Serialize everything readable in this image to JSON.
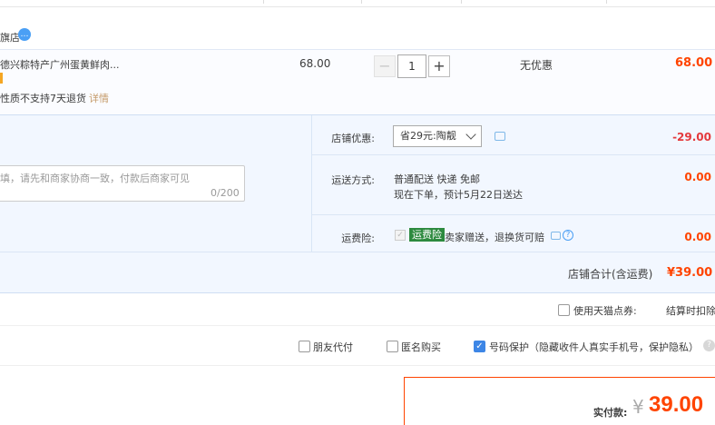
{
  "shop": {
    "name": "旗店"
  },
  "item": {
    "title": "德兴粽特产广州蛋黄鲜肉...",
    "note": "性质不支持7天退货",
    "note_link": "详情",
    "price": "68.00",
    "quantity": "1",
    "promo": "无优惠",
    "subtotal": "68.00"
  },
  "message": {
    "placeholder": "填，请先和商家协商一致，付款后商家可见",
    "counter": "0/200"
  },
  "discount": {
    "label": "店铺优惠:",
    "selected": "省29元:陶靓",
    "amount": "-29.00"
  },
  "shipping": {
    "label": "运送方式:",
    "line1": "普通配送 快递 免邮",
    "line2": "现在下单，预计5月22日送达",
    "amount": "0.00"
  },
  "insurance": {
    "label": "运费险:",
    "badge": "运费险",
    "text": "卖家赠送，退换货可赔",
    "amount": "0.00"
  },
  "shop_total": {
    "label": "店铺合计(含运费)",
    "value": "¥39.00"
  },
  "options": {
    "tmall_points": "使用天猫点券:",
    "tmall_note": "结算时扣除",
    "friend_pay": "朋友代付",
    "anonymous": "匿名购买",
    "phone_protect": "号码保护（隐藏收件人真实手机号，保护隐私）"
  },
  "payment": {
    "label": "实付款:",
    "currency": "¥",
    "value": "39.00"
  },
  "colors": {
    "accent": "#ff4400",
    "panel": "#f2f7ff",
    "badge": "#2d8a3f",
    "check": "#3d86e6"
  }
}
